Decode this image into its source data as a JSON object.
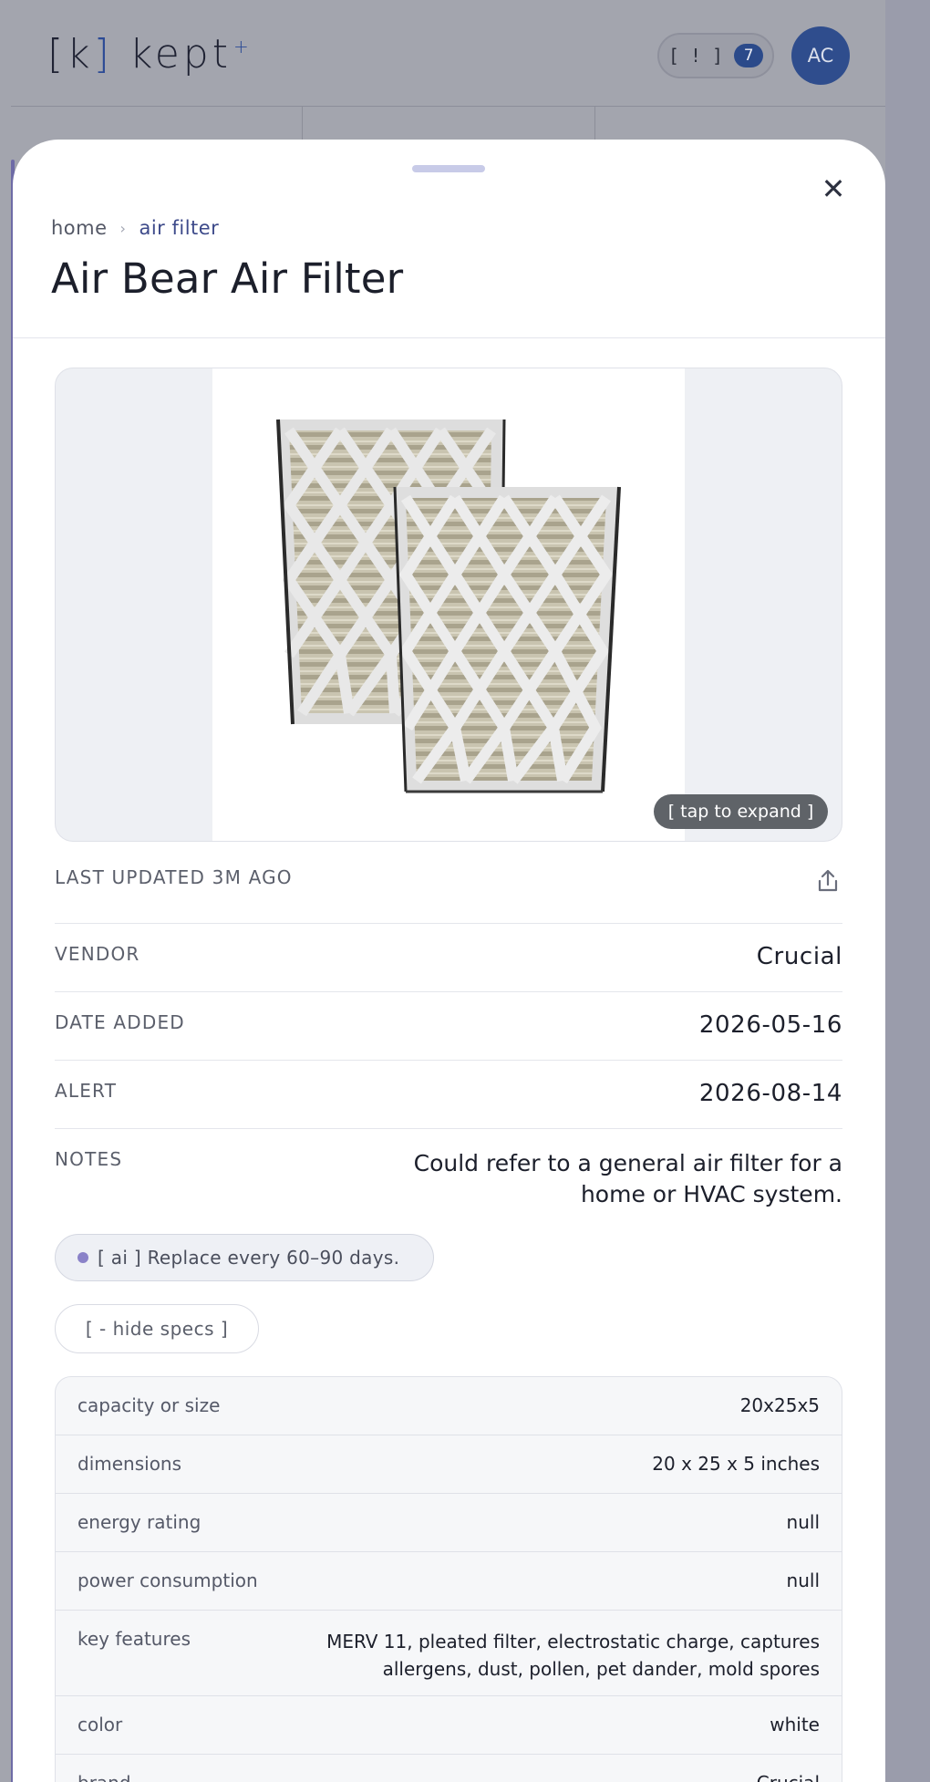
{
  "header": {
    "logo_open": "[",
    "logo_k": "k",
    "logo_close": "]",
    "logo_word": "kept",
    "logo_plus": "+",
    "alerts_label": "[ ! ]",
    "alerts_count": "7",
    "avatar_initials": "AC"
  },
  "sheet": {
    "close_label": "✕",
    "breadcrumb": {
      "home": "home",
      "separator": "›",
      "current": "air filter"
    },
    "title": "Air Bear Air Filter",
    "image": {
      "expand_label": "[ tap to expand ]"
    },
    "updated_label": "LAST UPDATED 3M AGO",
    "details": [
      {
        "label": "VENDOR",
        "value": "Crucial"
      },
      {
        "label": "DATE ADDED",
        "value": "2026-05-16"
      },
      {
        "label": "ALERT",
        "value": "2026-08-14"
      },
      {
        "label": "NOTES",
        "value": "Could refer to a general air filter for a home or HVAC system."
      }
    ],
    "ai_tip": "[ ai ] Replace every 60–90 days.",
    "specs_toggle": "[ - hide specs ]",
    "specs": [
      {
        "label": "capacity or size",
        "value": "20x25x5"
      },
      {
        "label": "dimensions",
        "value": "20 x 25 x 5 inches"
      },
      {
        "label": "energy rating",
        "value": "null"
      },
      {
        "label": "power consumption",
        "value": "null"
      },
      {
        "label": "key features",
        "value": "MERV 11, pleated filter, electrostatic charge, captures allergens, dust, pollen, pet dander, mold spores"
      },
      {
        "label": "color",
        "value": "white"
      },
      {
        "label": "brand",
        "value": "Crucial"
      }
    ]
  },
  "colors": {
    "accent": "#2b4a95",
    "breadcrumb_current": "#3d4a8a",
    "ai_dot": "#8a82c8",
    "expand_pill": "#5f6368"
  }
}
